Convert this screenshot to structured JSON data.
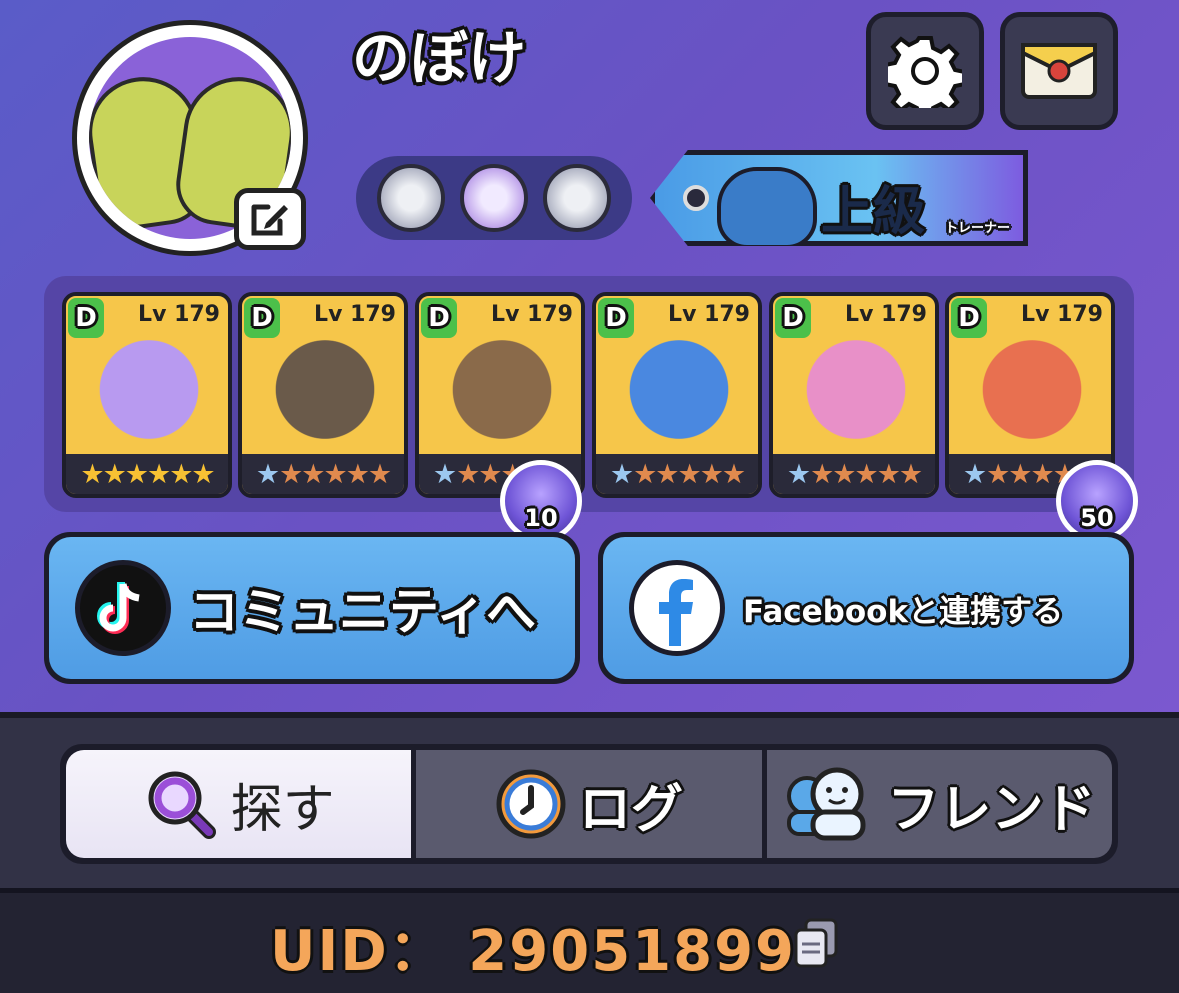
{
  "profile": {
    "username": "のぼけ",
    "rank": {
      "title": "上級",
      "subtitle": "トレーナー"
    }
  },
  "team": {
    "cards": [
      {
        "grade": "D",
        "level": "Lv 179",
        "stars": "gold",
        "color": "#b89af0"
      },
      {
        "grade": "D",
        "level": "Lv 179",
        "stars": "mixed",
        "color": "#6a5a4a"
      },
      {
        "grade": "D",
        "level": "Lv 179",
        "stars": "mixed",
        "color": "#8a6a4a",
        "orb_count": "10"
      },
      {
        "grade": "D",
        "level": "Lv 179",
        "stars": "mixed",
        "color": "#4a88e0"
      },
      {
        "grade": "D",
        "level": "Lv 179",
        "stars": "mixed",
        "color": "#e890c8"
      },
      {
        "grade": "D",
        "level": "Lv 179",
        "stars": "mixed",
        "color": "#e87050",
        "orb_count": "50"
      }
    ]
  },
  "actions": {
    "community_label": "コミュニティへ",
    "facebook_label": "Facebookと連携する"
  },
  "tabs": [
    {
      "label": "探す",
      "icon": "search-icon",
      "active": true
    },
    {
      "label": "ログ",
      "icon": "clock-icon",
      "active": false
    },
    {
      "label": "フレンド",
      "icon": "friends-icon",
      "active": false
    }
  ],
  "footer": {
    "uid_label": "UID：",
    "uid_value": "29051899"
  }
}
